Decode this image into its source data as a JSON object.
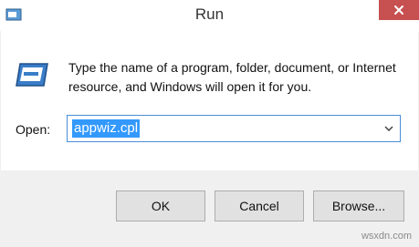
{
  "window": {
    "title": "Run",
    "close_icon": "close-icon",
    "app_icon": "run-app-icon",
    "close_color": "#c75050"
  },
  "dialog": {
    "icon": "run-dialog-icon",
    "message": "Type the name of a program, folder, document, or Internet resource, and Windows will open it for you.",
    "open_label": "Open:",
    "open_value": "appwiz.cpl",
    "dropdown_icon": "chevron-down-icon",
    "selection_color": "#3399ff"
  },
  "buttons": {
    "ok": "OK",
    "cancel": "Cancel",
    "browse": "Browse..."
  },
  "watermark": "wsxdn.com"
}
